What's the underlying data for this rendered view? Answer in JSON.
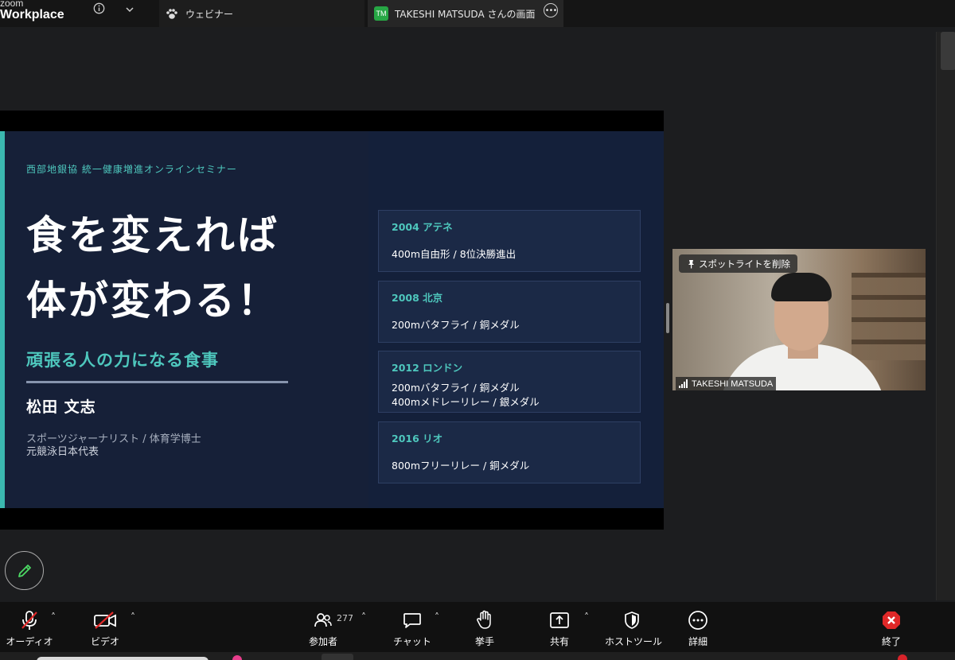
{
  "app": {
    "brand_top": "zoom",
    "brand_bottom": "Workplace"
  },
  "tabs": [
    {
      "label": "ウェビナー"
    },
    {
      "badge": "TM",
      "label": "TAKESHI MATSUDA さんの画面"
    }
  ],
  "slide": {
    "series": "西部地銀協 統一健康増進オンラインセミナー",
    "title_line1": "食を変えれば",
    "title_line2": "体が変わる！",
    "subtitle": "頑張る人の力になる食事",
    "speaker_name": "松田 文志",
    "role_line1": "スポーツジャーナリスト / 体育学博士",
    "role_line2": "元競泳日本代表",
    "cards": [
      {
        "year": "2004 アテネ",
        "line1": "400m自由形 / 8位決勝進出",
        "line2": ""
      },
      {
        "year": "2008 北京",
        "line1": "200mバタフライ / 銅メダル",
        "line2": ""
      },
      {
        "year": "2012 ロンドン",
        "line1": "200mバタフライ / 銅メダル",
        "line2": "400mメドレーリレー / 銀メダル"
      },
      {
        "year": "2016 リオ",
        "line1": "800mフリーリレー / 銅メダル",
        "line2": ""
      }
    ]
  },
  "video": {
    "spotlight_label": "スポットライトを削除",
    "participant_name": "TAKESHI MATSUDA"
  },
  "toolbar": {
    "audio": "オーディオ",
    "video": "ビデオ",
    "participants": "参加者",
    "participants_count": "277",
    "chat": "チャット",
    "raise_hand": "挙手",
    "share": "共有",
    "host_tools": "ホストツール",
    "more": "詳細",
    "end": "終了"
  },
  "colors": {
    "accent": "#4ec7bd",
    "slide_bg": "#162038",
    "end_red": "#e02828",
    "mute_red": "#e02828"
  }
}
